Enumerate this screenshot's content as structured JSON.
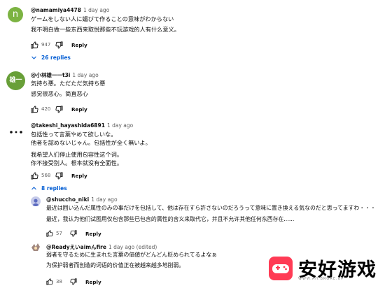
{
  "comments": [
    {
      "avatar_letter": "n",
      "avatar_color": "#7cb342",
      "author": "@namamiya4478",
      "time": "1 day ago",
      "lines": [
        "ゲームをしない人に媚びて作ることの意味がわからない",
        "我不明白做一些东西来取悦那些不玩游戏的人有什么意义。"
      ],
      "likes": "947",
      "reply_label": "Reply",
      "replies_toggle": "26 replies"
    },
    {
      "avatar_letter": "雄一",
      "avatar_color": "#689f38",
      "author": "@小林雄一一t3i",
      "time": "1 day ago",
      "lines": [
        "気持ち悪。ただただ気持ち悪",
        "感觉很恶心。简直恶心"
      ],
      "likes": "420",
      "reply_label": "Reply"
    },
    {
      "avatar_letter": "",
      "avatar_color": "#ffffff",
      "author": "@takeshi_hayashida6891",
      "time": "1 day ago",
      "lines": [
        "包括性って言葉やめて欲しいな。",
        "他者を認めないじゃん。包括性が全く無いよ。",
        "我希望人们停止使用包容性这个词。",
        "你不接受别人。根本就没有全面性。"
      ],
      "likes": "568",
      "reply_label": "Reply",
      "replies_toggle": "8 replies"
    }
  ],
  "replies": [
    {
      "author": "@shuccho_niki",
      "time": "1 day ago",
      "lines": [
        "最近は囲い込んだ属性のみの事だけを包括して、他は存在すら許さないのだろうって意味に置き換える気なのだと思ってますわ・・・",
        "最近，我认为他们试图用仅包含那些已包含的属性的含义来取代它，并且不允许其他任何东西存在......"
      ],
      "likes": "57",
      "reply_label": "Reply"
    },
    {
      "author": "@Readyえいaimんfire",
      "time": "1 day ago (edited)",
      "lines": [
        "弱者を守るために生まれた言葉の価値がどんどん貶められてるよなぁ",
        "为保护弱者而创造的词语的价值正在被越来越多地削弱。"
      ],
      "likes": "38",
      "reply_label": "Reply"
    }
  ],
  "watermark": {
    "title": "安好游戏",
    "sub": "WWW.AH.BRORE.UP"
  }
}
